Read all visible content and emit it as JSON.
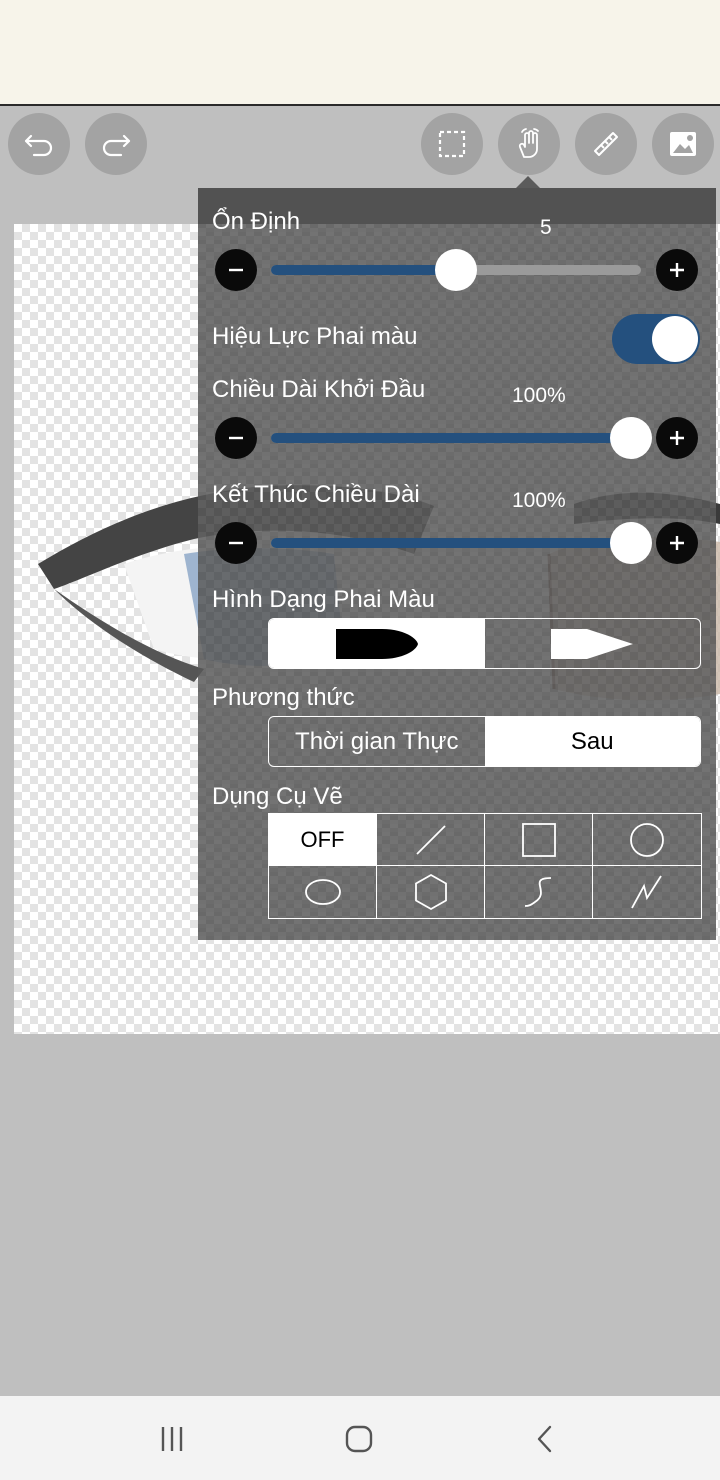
{
  "toolbar": {
    "icons": [
      "undo-icon",
      "redo-icon",
      "selection-icon",
      "hand-pan-icon",
      "ruler-icon",
      "image-layer-icon"
    ]
  },
  "panel": {
    "stabilizer": {
      "label": "Ổn Định",
      "value": "5",
      "level": 0.5
    },
    "fade_effect": {
      "label": "Hiệu Lực Phai màu",
      "on": true
    },
    "start_length": {
      "label": "Chiều Dài Khởi Đầu",
      "value": "100%",
      "level": 1.0
    },
    "end_length": {
      "label": "Kết Thúc Chiều Dài",
      "value": "100%",
      "level": 1.0
    },
    "fade_shape": {
      "label": "Hình Dạng Phai Màu",
      "options": [
        "rounded-tip-shape",
        "pointed-tip-shape"
      ],
      "selected": 0
    },
    "method": {
      "label": "Phương thức",
      "options": [
        "Thời gian Thực",
        "Sau"
      ],
      "selected": 1
    },
    "drawing_tools": {
      "label": "Dụng Cụ Vẽ",
      "off_label": "OFF",
      "tools": [
        "off",
        "line-icon",
        "rectangle-icon",
        "circle-icon",
        "ellipse-icon",
        "polygon-icon",
        "curve-icon",
        "polyline-icon"
      ]
    }
  },
  "colors": {
    "accent": "#24507e",
    "panel": "#585858",
    "background": "#bfbfbf"
  },
  "navbar": {
    "icons": [
      "recent-apps-icon",
      "home-icon",
      "back-icon"
    ]
  }
}
